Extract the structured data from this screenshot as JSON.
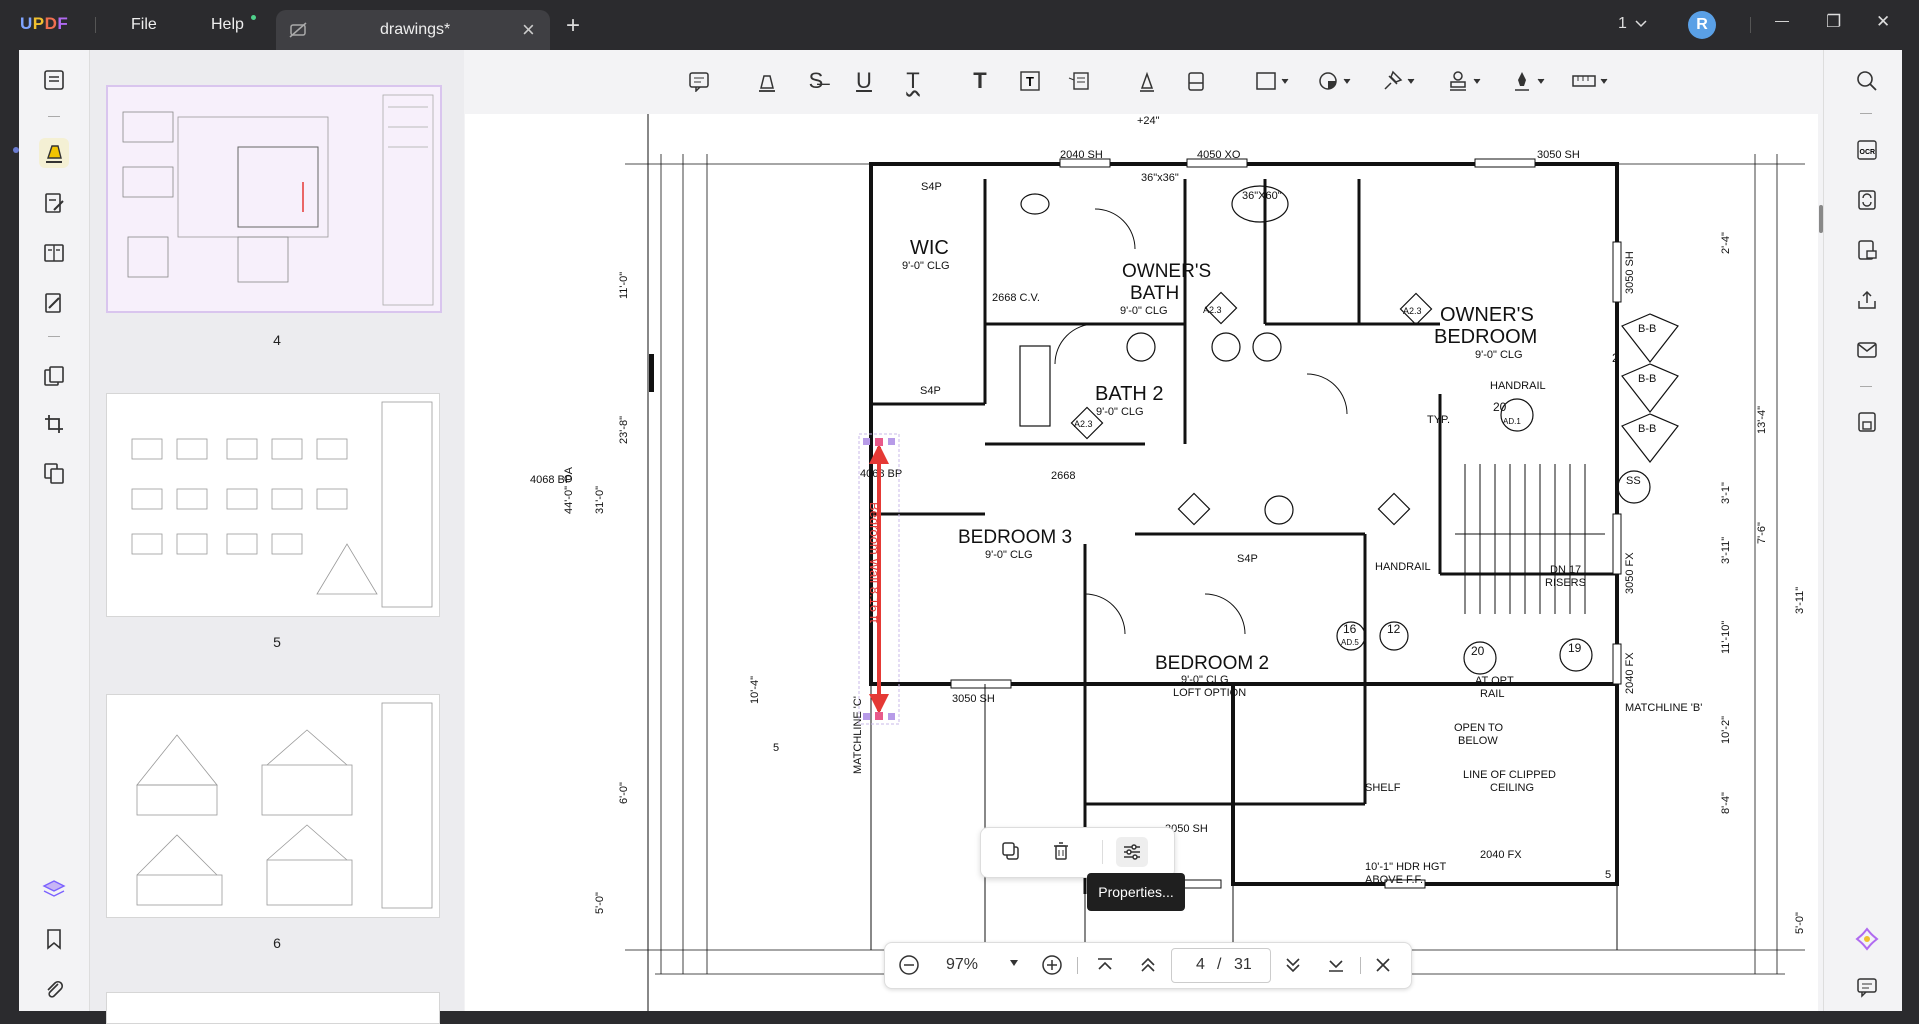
{
  "app": {
    "logo": "UPDF"
  },
  "menu": {
    "file": "File",
    "help": "Help"
  },
  "tab": {
    "title": "drawings*",
    "close": "×",
    "new_tab": "+"
  },
  "window": {
    "page_indicator": "1",
    "avatar_letter": "R",
    "minimize": "—",
    "restore": "❐",
    "close": "✕"
  },
  "thumbnails": [
    {
      "page": "4",
      "selected": true
    },
    {
      "page": "5",
      "selected": false
    },
    {
      "page": "6",
      "selected": false
    }
  ],
  "bottombar": {
    "zoom": "97%",
    "current_page": "4",
    "separator": "/",
    "total_pages": "31"
  },
  "popup": {
    "tooltip": "Properties..."
  },
  "drawing": {
    "labels": {
      "wic": "WIC",
      "wic_clg": "9'-0\" CLG",
      "owners_bath": "OWNER'S",
      "owners_bath2": "BATH",
      "owners_bath_clg": "9'-0\" CLG",
      "owners_bedroom": "OWNER'S",
      "owners_bedroom2": "BEDROOM",
      "owners_bedroom_clg": "9'-0\" CLG",
      "bath2": "BATH 2",
      "bath2_clg": "9'-0\" CLG",
      "bedroom3": "BEDROOM 3",
      "bedroom3_clg": "9'-0\" CLG",
      "bedroom2": "BEDROOM 2",
      "bedroom2_clg": "9'-0\" CLG",
      "bedroom2_loft": "LOFT OPTION",
      "handrail": "HANDRAIL",
      "handrail2": "HANDRAIL",
      "dn_risers": "DN 17",
      "risers": "RISERS",
      "open_to_below": "OPEN TO",
      "open_to_below2": "BELOW",
      "line_clipped": "LINE OF CLIPPED",
      "line_clipped2": "CEILING",
      "at_opt_rail": "AT OPT.",
      "at_opt_rail2": "RAIL",
      "matchline_b": "MATCHLINE 'B'",
      "matchline_c": "MATCHLINE 'C'",
      "hdr_hgt": "10'-1\" HDR HGT",
      "hdr_hgt2": "ABOVE F.F.",
      "shelf": "SHELF",
      "typ": "TYP.",
      "dim_3050sh_top": "3050 SH",
      "dim_2040sh": "2040 SH",
      "dim_4050xo": "4050 XO",
      "dim_24": "+24\"",
      "dim_36x36": "36\"x36\"",
      "dim_36x60": "36\"X60\"",
      "dim_3050sh_bot": "3050 SH",
      "dim_3050sh_b2": "3050 SH",
      "dim_2040fx": "2040 FX",
      "dim_2040fx_v": "2040 FX",
      "dim_3050fx_v": "3050 FX",
      "dim_3050sh_v": "3050 SH",
      "dim_44": "44'-0\" OA",
      "dim_23_8": "23'-8\"",
      "dim_31_0": "31'-0\"",
      "dim_10_4": "10'-4\"",
      "dim_6_0": "6'-0\"",
      "dim_5_0": "5'-0\"",
      "dim_11_0": "11'-0\"",
      "dim_2_4": "2'-4\"",
      "dim_13_4": "13'-4\"",
      "dim_7_6": "7'-6\"",
      "dim_10_2": "10'-2\"",
      "dim_8_4": "8'-4\"",
      "dim_11_10": "11'-10\"",
      "dim_3_11": "3'-11\"",
      "dim_3_1": "3'-1\"",
      "dim_4068bp": "4068 BP",
      "dim_2668": "2668",
      "dim_2668cv": "2668 C.V.",
      "dim_sp": "S4P",
      "tag_a23": "A2.3",
      "tag_20": "20",
      "tag_ad1": "AD.1",
      "tag_16": "16",
      "tag_12": "12",
      "tag_ad5": "AD.5",
      "tag_19": "19",
      "tag_5": "5",
      "tag_bb": "B-B",
      "tag_a32": "A3.A2",
      "tag_a3b2": "A3.B2",
      "tag_a3c2": "A3.C2",
      "tag_ss": "SS",
      "tag_2": "2"
    },
    "measurement": {
      "label": "Bedroom Wall 8.16 ft",
      "color": "#e53935"
    }
  },
  "colors": {
    "accent": "#7b61ff",
    "title_bg": "#2b2b2e",
    "measure": "#e53935"
  }
}
